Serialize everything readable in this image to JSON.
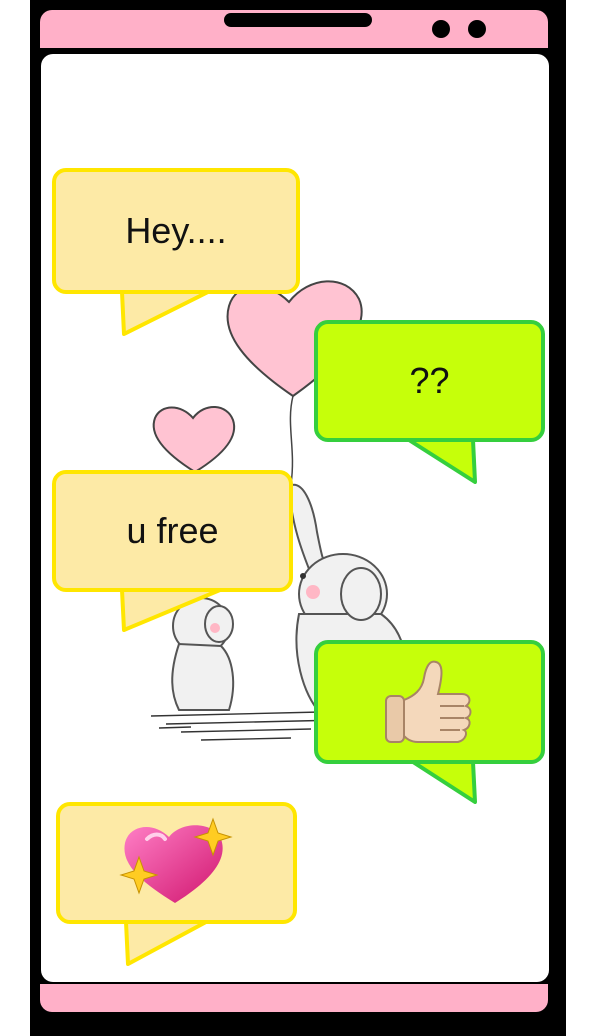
{
  "chat": {
    "messages": [
      {
        "sender": "me",
        "text": "Hey...."
      },
      {
        "sender": "them",
        "text": "??"
      },
      {
        "sender": "me",
        "text": "u free"
      },
      {
        "sender": "them",
        "icon": "thumbs-up-emoji"
      },
      {
        "sender": "me",
        "icon": "sparkling-heart-emoji"
      }
    ]
  },
  "theme": {
    "phone_frame": "#ffb0c8",
    "my_bubble_fill": "#fdeaa6",
    "my_bubble_border": "#ffe600",
    "their_bubble_fill": "#c6ff0a",
    "their_bubble_border": "#35cf3d"
  },
  "wallpaper": {
    "icon": "elephants-with-heart-balloons-illustration"
  }
}
